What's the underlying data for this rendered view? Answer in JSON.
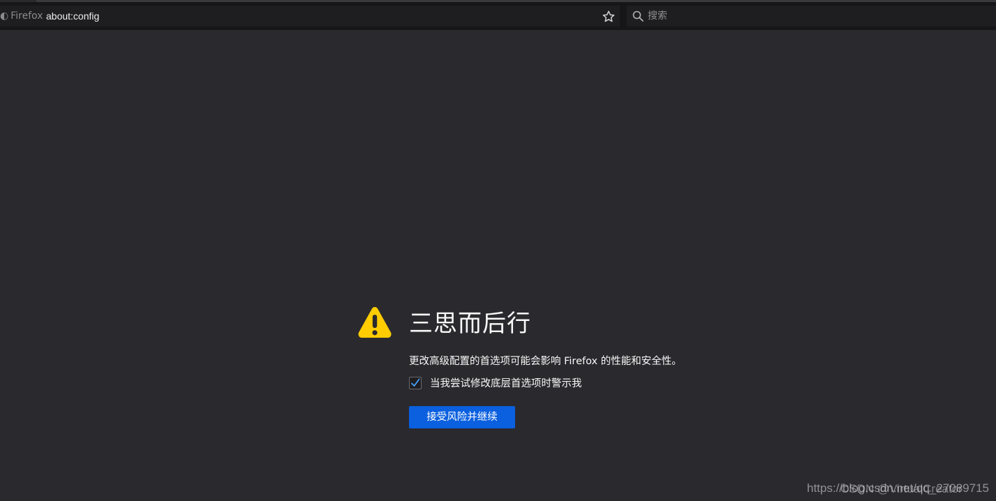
{
  "toolbar": {
    "identity_label": "Firefox",
    "url": "about:config",
    "search_placeholder": "搜索",
    "bookmark_icon": "star-icon",
    "search_icon": "search-icon"
  },
  "warning": {
    "icon": "warning-triangle-icon",
    "icon_color": "#ffcc00",
    "title": "三思而后行",
    "description": "更改高级配置的首选项可能会影响 Firefox 的性能和安全性。",
    "checkbox_label": "当我尝试修改底层首选项时警示我",
    "checkbox_checked": true,
    "accept_button": "接受风险并继续",
    "accent_color": "#0a60df"
  },
  "watermark": {
    "text": "https://blog.csdn.net/qq_27089715",
    "overlay_text": "CSDN @VirtualCreator"
  }
}
